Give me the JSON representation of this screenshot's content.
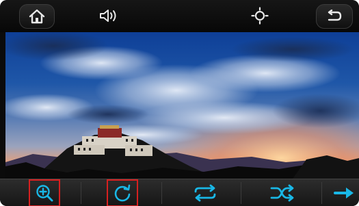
{
  "topbar": {
    "icons": [
      "home-icon",
      "volume-icon",
      "brightness-icon",
      "back-icon"
    ]
  },
  "photo": {
    "subject": "potala-palace-sunset"
  },
  "toolbar": {
    "icons": [
      "zoom-in-icon",
      "rotate-icon",
      "repeat-icon",
      "shuffle-icon",
      "next-arrow-icon"
    ],
    "accent_color": "#19b7e6",
    "highlight_color": "#d82020"
  }
}
